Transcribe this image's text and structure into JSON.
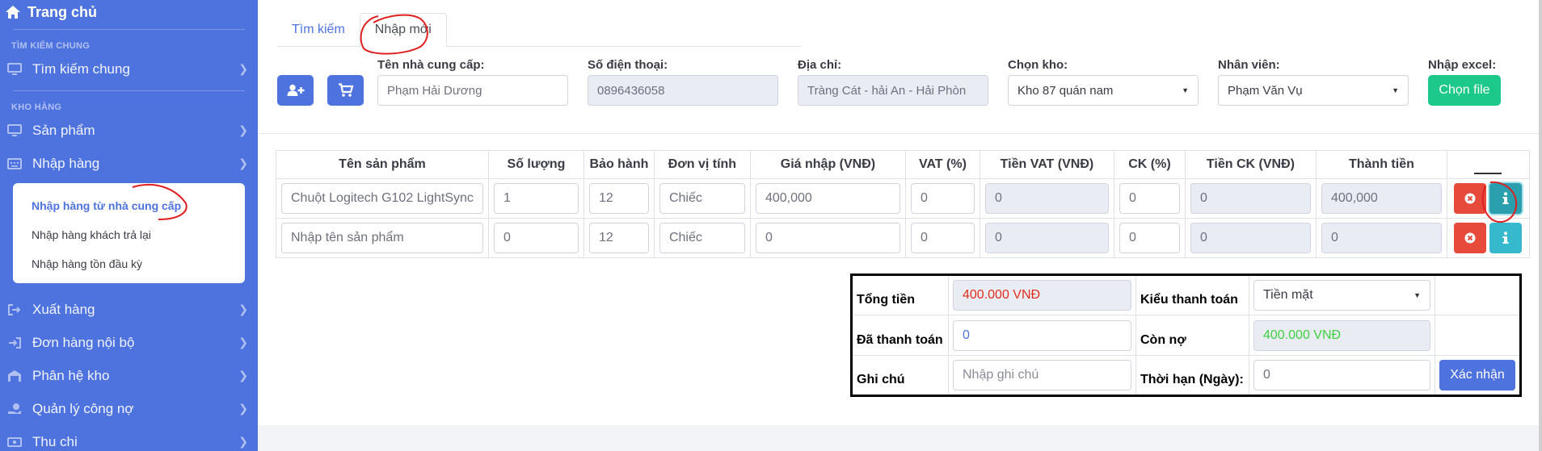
{
  "sidebar": {
    "home_label": "Trang chủ",
    "heading_search": "TÌM KIẾM CHUNG",
    "item_search": "Tìm kiếm chung",
    "heading_warehouse": "KHO HÀNG",
    "item_products": "Sản phẩm",
    "item_import": "Nhập hàng",
    "submenu": [
      "Nhập hàng từ nhà cung cấp",
      "Nhập hàng khách trả lại",
      "Nhập hàng tồn đầu kỳ"
    ],
    "item_export": "Xuất hàng",
    "item_internal": "Đơn hàng nội bộ",
    "item_subsystem": "Phân hệ kho",
    "item_debt": "Quản lý công nợ",
    "item_cash": "Thu chi"
  },
  "tabs": [
    "Tìm kiếm",
    "Nhập mới"
  ],
  "form": {
    "supplier_label": "Tên nhà cung cấp:",
    "supplier_value": "Phạm Hải Dương",
    "phone_label": "Số điện thoại:",
    "phone_value": "0896436058",
    "address_label": "Địa chỉ:",
    "address_value": "Tràng Cát - hải An - Hải Phòn",
    "warehouse_label": "Chọn kho:",
    "warehouse_value": "Kho 87 quán nam",
    "staff_label": "Nhân viên:",
    "staff_value": "Phạm Văn Vụ",
    "excel_label": "Nhập excel:",
    "excel_button": "Chọn file"
  },
  "table": {
    "headers": [
      "Tên sản phẩm",
      "Số lượng",
      "Bảo hành",
      "Đơn vị tính",
      "Giá nhập (VNĐ)",
      "VAT (%)",
      "Tiền VAT (VNĐ)",
      "CK (%)",
      "Tiền CK (VNĐ)",
      "Thành tiền"
    ],
    "rows": [
      {
        "name": "Chuột Logitech G102 LightSync",
        "qty": "1",
        "warranty": "12",
        "unit": "Chiếc",
        "price": "400,000",
        "vat": "0",
        "vat_amount": "0",
        "ck": "0",
        "ck_amount": "0",
        "total": "400,000"
      },
      {
        "name": "",
        "name_placeholder": "Nhập tên sản phẩm",
        "qty": "0",
        "warranty": "12",
        "unit": "Chiếc",
        "price": "0",
        "vat": "0",
        "vat_amount": "0",
        "ck": "0",
        "ck_amount": "0",
        "total": "0"
      }
    ]
  },
  "summary": {
    "total_label": "Tổng tiền",
    "total_value": "400.000 VNĐ",
    "payment_type_label": "Kiểu thanh toán",
    "payment_type_value": "Tiền mặt",
    "paid_label": "Đã thanh toán",
    "paid_value": "0",
    "debt_label": "Còn nợ",
    "debt_value": "400.000 VNĐ",
    "note_label": "Ghi chú",
    "note_placeholder": "Nhập ghi chú",
    "term_label": "Thời hạn (Ngày):",
    "term_value": "0",
    "confirm_button": "Xác nhận"
  },
  "colors": {
    "sidebar": "#4e73df",
    "primary": "#4e73df",
    "success": "#1cc88a",
    "danger": "#e74a3b",
    "info": "#36b9cc",
    "total_text": "#e02d1b",
    "debt_text": "#3fcf3f",
    "annotation": "#e02020"
  }
}
